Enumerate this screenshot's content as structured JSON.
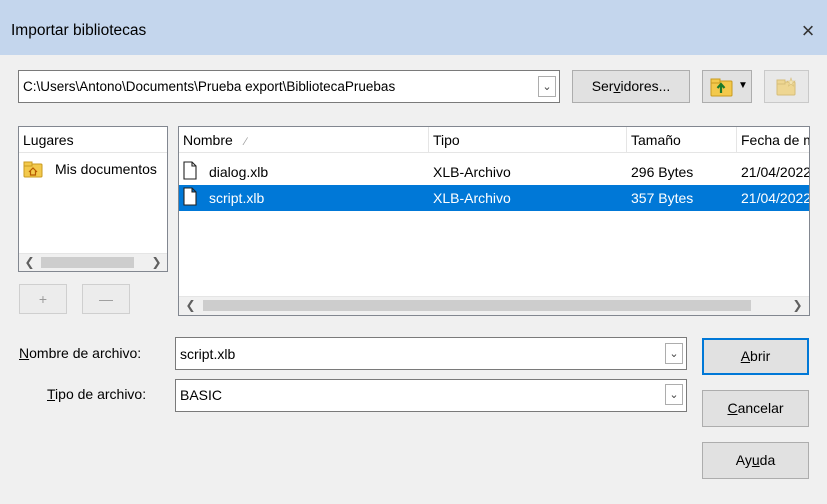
{
  "window": {
    "title": "Importar bibliotecas",
    "close_glyph": "×"
  },
  "toolbar": {
    "path": "C:\\Users\\Antono\\Documents\\Prueba export\\BibliotecaPruebas",
    "servers_label": "Servidores...",
    "up_icon": "folder-up-icon",
    "new_folder_icon": "new-folder-icon"
  },
  "places": {
    "header": "Lugares",
    "items": [
      {
        "label": "Mis documentos",
        "icon": "folder-home-icon"
      }
    ],
    "add_label": "+",
    "remove_label": "—"
  },
  "files": {
    "columns": [
      "Nombre",
      "Tipo",
      "Tamaño",
      "Fecha de modificación"
    ],
    "sort_indicator": "∕",
    "rows": [
      {
        "name": "dialog.xlb",
        "type": "XLB-Archivo",
        "size": "296 Bytes",
        "date": "21/04/2022",
        "selected": false
      },
      {
        "name": "script.xlb",
        "type": "XLB-Archivo",
        "size": "357 Bytes",
        "date": "21/04/2022",
        "selected": true
      }
    ]
  },
  "form": {
    "filename_label": "Nombre de archivo:",
    "filename_value": "script.xlb",
    "filetype_label": "Tipo de archivo:",
    "filetype_value": "BASIC"
  },
  "buttons": {
    "open": "Abrir",
    "cancel": "Cancelar",
    "help": "Ayuda"
  },
  "colors": {
    "titlebar": "#c4d6ed",
    "selection": "#0078d7",
    "folder": "#f3c94c"
  }
}
